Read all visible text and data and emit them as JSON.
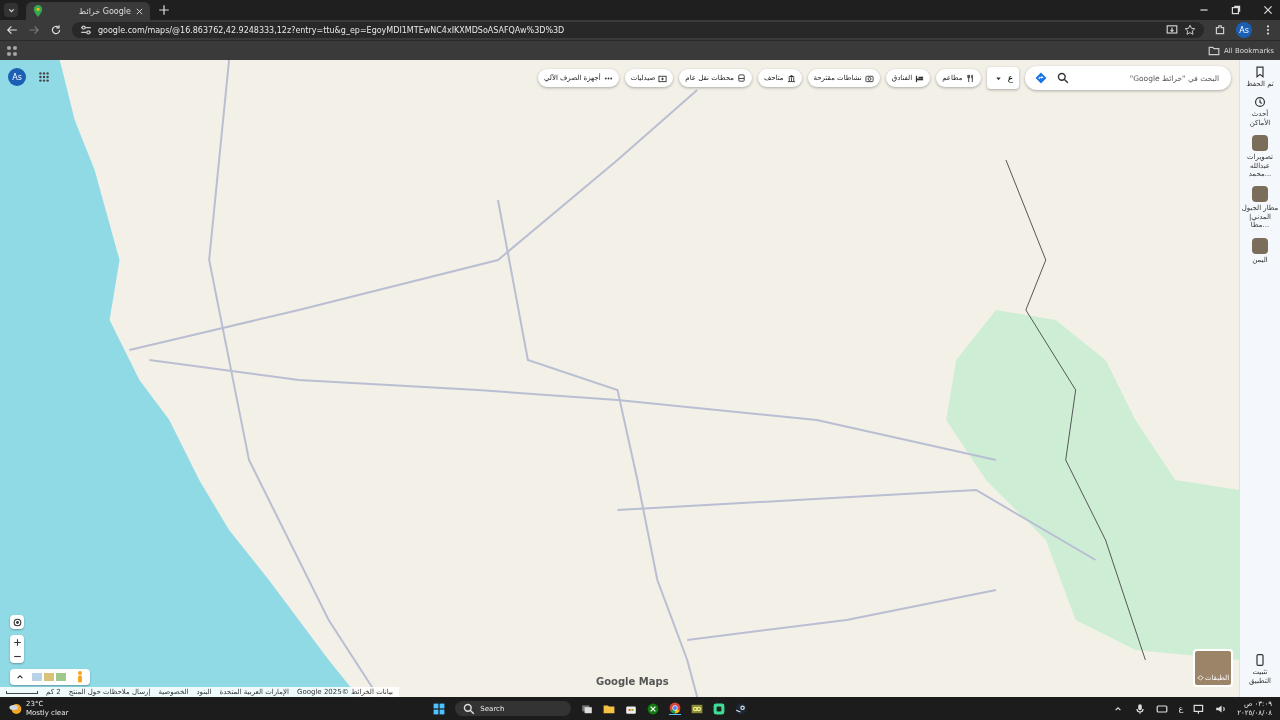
{
  "browser": {
    "tab_title": "خرائط Google",
    "url": "google.com/maps/@16.863762,42.9248333,12z?entry=ttu&g_ep=EgoyMDI1MTEwNC4xIKXMDSoASAFQAw%3D%3D",
    "profile": "As",
    "bookmarks_label": "All Bookmarks"
  },
  "maps": {
    "account": "As",
    "search": {
      "placeholder": "البحث في \"خرائط Google\""
    },
    "language": "ع",
    "chips": [
      {
        "kind": "restaurant",
        "label": "مطاعم"
      },
      {
        "kind": "hotel",
        "label": "الفنادق"
      },
      {
        "kind": "camera",
        "label": "نشاطات مقترحة"
      },
      {
        "kind": "museum",
        "label": "متاحف"
      },
      {
        "kind": "transit",
        "label": "محطات نقل عام"
      },
      {
        "kind": "pharmacy",
        "label": "صيدليات"
      },
      {
        "kind": "atm",
        "label": "أجهزة الصرف الآلي"
      }
    ],
    "sidebar": [
      {
        "kind": "saved",
        "label": "تم الحفظ"
      },
      {
        "kind": "recent",
        "label": "أحدث الأماكن"
      },
      {
        "kind": "place",
        "label": "تصويرات عبدالله محمد..."
      },
      {
        "kind": "place",
        "label": "مطار الجبول المدني| مطا..."
      },
      {
        "kind": "place",
        "label": "اليمن"
      },
      {
        "kind": "install",
        "label": "تثبيت التطبيق"
      }
    ],
    "layers_label": "الطبقات",
    "logo": "Google Maps",
    "footer": [
      "بيانات الخرائط ©2025 Google",
      "الإمارات العربية المتحدة",
      "البنود",
      "الخصوصية",
      "إرسال ملاحظات حول المنتج"
    ],
    "scale": "2 كم"
  },
  "taskbar": {
    "weather_temp": "23°C",
    "weather_text": "Mostly clear",
    "search": "Search",
    "keyboard": "ع",
    "time": "٠٣:٠٩ ص",
    "date": "٢٠٢٥/٠٨/٠٨"
  }
}
